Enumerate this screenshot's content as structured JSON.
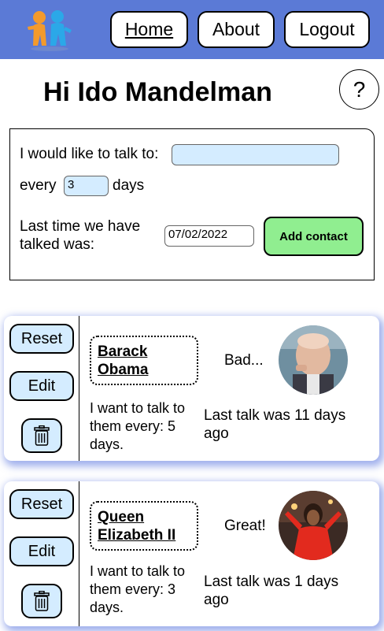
{
  "header": {
    "nav": {
      "home": "Home",
      "about": "About",
      "logout": "Logout"
    },
    "color": "#5b7ad6"
  },
  "greeting": "Hi Ido Mandelman",
  "help_label": "?",
  "form": {
    "talk_to_label": "I would like to talk to:",
    "talk_to_value": "",
    "every_label": "every",
    "every_value": "3",
    "days_label": "days",
    "last_time_label_1": "Last time we have",
    "last_time_label_2": "talked was:",
    "date_value": "07/02/2022",
    "add_button": "Add contact"
  },
  "contacts": [
    {
      "reset": "Reset",
      "edit": "Edit",
      "name_line1": "Barack",
      "name_line2": "Obama",
      "freq_line1": "I want to talk to",
      "freq_line2": "them every: 5",
      "freq_line3": "days.",
      "mood": "Bad...",
      "last_line1": "Last talk was 11 days",
      "last_line2": "ago"
    },
    {
      "reset": "Reset",
      "edit": "Edit",
      "name_line1": "Queen",
      "name_line2": "Elizabeth II",
      "freq_line1": "I want to talk to",
      "freq_line2": "them every: 3",
      "freq_line3": "days.",
      "mood": "Great!",
      "last_line1": "Last talk was 1 days",
      "last_line2": "ago"
    }
  ],
  "colors": {
    "accent_blue": "#d4ecff",
    "add_green": "#90ee90"
  },
  "icons": {
    "logo": "people-talking-logo",
    "trash": "trash-icon"
  }
}
